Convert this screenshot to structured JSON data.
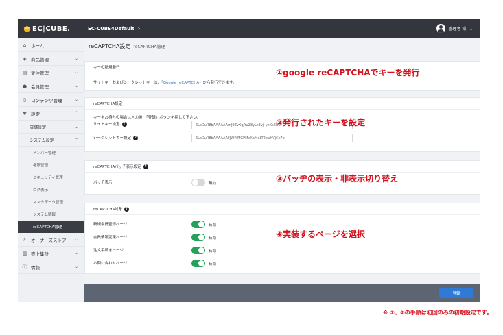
{
  "header": {
    "logo_text": "EC|CUBE.",
    "shop_name": "EC-CUBE4Default",
    "shop_chevron": "›",
    "user_label": "管理者 様",
    "user_chevron": "⌄",
    "colors": {
      "bar": "#33363d",
      "logo_accent": "#f2b11c"
    }
  },
  "sidebar": {
    "items": [
      {
        "icon": "home-icon",
        "glyph": "⌂",
        "label": "ホーム",
        "arrow": ""
      },
      {
        "icon": "cube-icon",
        "glyph": "◈",
        "label": "商品管理",
        "arrow": "⌄"
      },
      {
        "icon": "cart-icon",
        "glyph": "▤",
        "label": "受注管理",
        "arrow": "⌄"
      },
      {
        "icon": "users-icon",
        "glyph": "●",
        "label": "会員管理",
        "arrow": "⌄"
      },
      {
        "icon": "file-icon",
        "glyph": "▯",
        "label": "コンテンツ管理",
        "arrow": "⌄"
      },
      {
        "icon": "gear-icon",
        "glyph": "✱",
        "label": "設定",
        "arrow": "⌃"
      }
    ],
    "sub_items": [
      {
        "label": "店舗設定",
        "arrow": "⌄"
      },
      {
        "label": "システム設定",
        "arrow": "⌃"
      }
    ],
    "leaf_items": [
      {
        "label": "メンバー管理"
      },
      {
        "label": "権限管理"
      },
      {
        "label": "セキュリティ管理"
      },
      {
        "label": "ログ表示"
      },
      {
        "label": "マスタデータ管理"
      },
      {
        "label": "システム情報"
      },
      {
        "label": "reCAPTCHA管理",
        "active": true
      }
    ],
    "bottom_items": [
      {
        "icon": "plug-icon",
        "glyph": "⚡",
        "label": "オーナーズストア",
        "arrow": "⌄"
      },
      {
        "icon": "chart-icon",
        "glyph": "▥",
        "label": "売上集計",
        "arrow": "⌄"
      },
      {
        "icon": "info-icon",
        "glyph": "ⓘ",
        "label": "情報",
        "arrow": "⌄"
      }
    ]
  },
  "page": {
    "title": "reCAPTCHA設定",
    "subtitle": "reCAPTCHA管理"
  },
  "card1": {
    "header": "キーの新規発行",
    "text_before": "サイトキーおよびシークレットキーは、",
    "link": "「Google reCAPTCHA」",
    "text_after": "から発行できます。"
  },
  "card2": {
    "header": "reCAPTCHA設定",
    "note": "キーをお持ちの場合は入力後、「登録」ボタンを押して下さい。",
    "site_key_label": "サイトキー設定",
    "site_key_value": "6LeDuR8bAAAAAAmJ9ZvXqjYuZ8yLc8vj_yeKsEO0",
    "secret_key_label": "シークレットキー設定",
    "secret_key_value": "6LeDuR8bAAAAAAFJWFfMGPMvXpMdLT2owKVjCx7e"
  },
  "card3": {
    "header": "reCAPTCHAバッチ表示設定",
    "badge_label": "バッチ表示",
    "badge_state": "無効",
    "badge_on": false
  },
  "card4": {
    "header": "reCAPTCHA対象",
    "rows": [
      {
        "label": "新規会員登録ページ",
        "state": "有効",
        "on": true
      },
      {
        "label": "会員情報変更ページ",
        "state": "有効",
        "on": true
      },
      {
        "label": "注文手続きページ",
        "state": "有効",
        "on": true
      },
      {
        "label": "お問い合わせページ",
        "state": "有効",
        "on": true
      }
    ]
  },
  "footer": {
    "submit_label": "登録",
    "colors": {
      "bar": "#5d6472",
      "button": "#2f7ad7",
      "toggle_on": "#25a25a"
    }
  },
  "annotations": {
    "a1": "①google reCAPTCHAでキーを発行",
    "a2": "②発行されたキーを設定",
    "a3": "③バッヂの表示・非表示切り替え",
    "a4": "④実装するページを選択",
    "note": "※ ①、②の手順は初回のみの初期設定です。",
    "color": "#d4121d"
  }
}
